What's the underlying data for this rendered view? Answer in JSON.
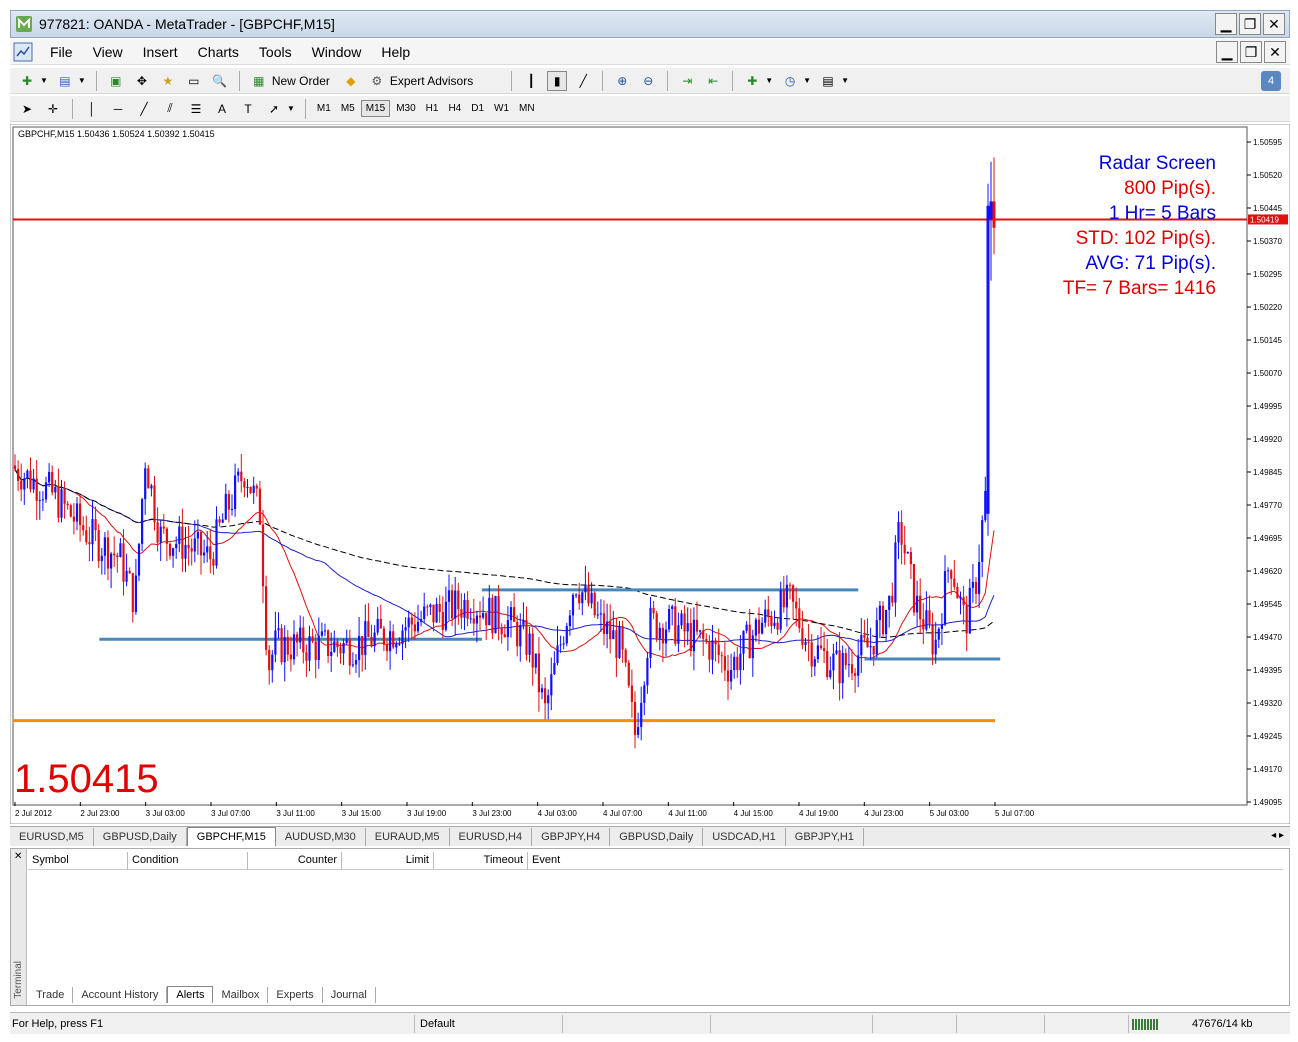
{
  "window": {
    "title": "977821: OANDA - MetaTrader - [GBPCHF,M15]",
    "minimize": "▁",
    "restore": "❐",
    "close": "✕"
  },
  "menu": [
    "File",
    "View",
    "Insert",
    "Charts",
    "Tools",
    "Window",
    "Help"
  ],
  "toolbar": {
    "new_order": "New Order",
    "expert_advisors": "Expert Advisors",
    "badge": "4"
  },
  "timeframes": [
    "M1",
    "M5",
    "M15",
    "M30",
    "H1",
    "H4",
    "D1",
    "W1",
    "MN"
  ],
  "active_timeframe": "M15",
  "chart": {
    "header": "GBPCHF,M15  1.50436 1.50524 1.50392 1.50415",
    "current_price_tag": "1.50419",
    "big_price": "1.50415",
    "radar": {
      "title": "Radar Screen",
      "pips": "800 Pip(s).",
      "hr": "1 Hr= 5 Bars",
      "std": "STD: 102 Pip(s).",
      "avg": "AVG: 71 Pip(s).",
      "tf": "TF= 7 Bars= 1416"
    },
    "colors": {
      "bull": "#1010ff",
      "bear": "#e01010",
      "price_line": "#e01010",
      "support": "#ff8c00",
      "levels": "#4a86b8",
      "ma_fast": "#e01010",
      "ma_slow": "#2020c0",
      "text_blue": "#0000dd",
      "text_red": "#e00000"
    }
  },
  "chart_data": {
    "type": "candlestick",
    "symbol": "GBPCHF,M15",
    "ylim": [
      1.49095,
      1.50595
    ],
    "y_ticks": [
      "1.50595",
      "1.50520",
      "1.50445",
      "1.50370",
      "1.50295",
      "1.50220",
      "1.50145",
      "1.50070",
      "1.49995",
      "1.49920",
      "1.49845",
      "1.49770",
      "1.49695",
      "1.49620",
      "1.49545",
      "1.49470",
      "1.49395",
      "1.49320",
      "1.49245",
      "1.49170",
      "1.49095"
    ],
    "x_ticks": [
      "2 Jul 2012",
      "2 Jul 23:00",
      "3 Jul 03:00",
      "3 Jul 07:00",
      "3 Jul 11:00",
      "3 Jul 15:00",
      "3 Jul 19:00",
      "3 Jul 23:00",
      "4 Jul 03:00",
      "4 Jul 07:00",
      "4 Jul 11:00",
      "4 Jul 15:00",
      "4 Jul 19:00",
      "4 Jul 23:00",
      "5 Jul 03:00",
      "5 Jul 07:00"
    ],
    "price_line": 1.50419,
    "support_line": 1.4928,
    "level_lines": [
      {
        "value": 1.49465,
        "from": 0.07,
        "to": 0.38
      },
      {
        "value": 1.49577,
        "from": 0.38,
        "to": 0.685
      },
      {
        "value": 1.4942,
        "from": 0.69,
        "to": 0.8
      }
    ]
  },
  "chart_tabs": [
    "EURUSD,M5",
    "GBPUSD,Daily",
    "GBPCHF,M15",
    "AUDUSD,M30",
    "EURAUD,M5",
    "EURUSD,H4",
    "GBPJPY,H4",
    "GBPUSD,Daily",
    "USDCAD,H1",
    "GBPJPY,H1"
  ],
  "active_chart_tab": 2,
  "terminal": {
    "side_label": "Terminal",
    "columns": [
      "Symbol",
      "Condition",
      "Counter",
      "Limit",
      "Timeout",
      "Event"
    ],
    "tabs": [
      "Trade",
      "Account History",
      "Alerts",
      "Mailbox",
      "Experts",
      "Journal"
    ],
    "active_tab": 2
  },
  "status": {
    "help": "For Help, press F1",
    "profile": "Default",
    "traffic": "47676/14 kb"
  }
}
